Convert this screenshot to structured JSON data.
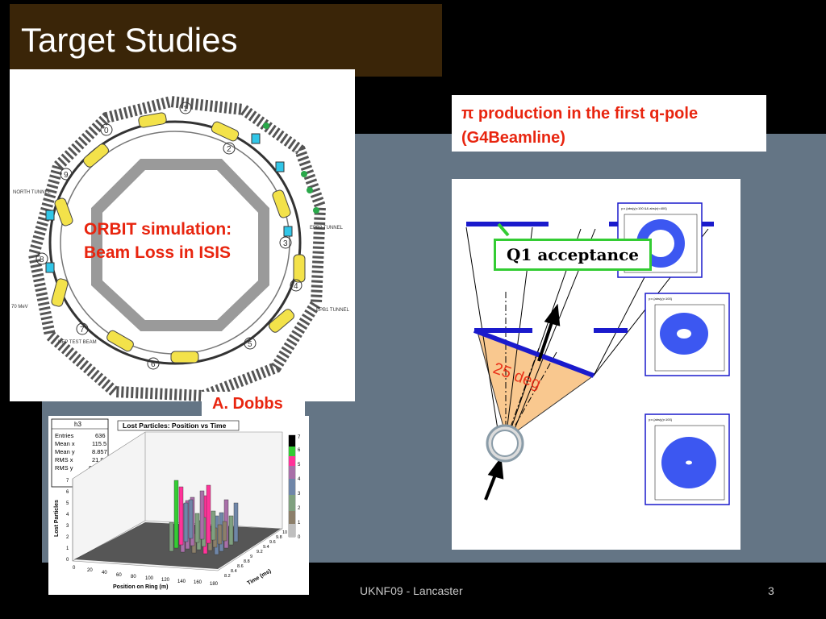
{
  "slide": {
    "title": "Target Studies",
    "footer_center": "UKNF09 - Lancaster",
    "page_number": "3"
  },
  "ring": {
    "label": "ORBIT simulation: Beam Loss in ISIS",
    "ring_numbers": [
      "1",
      "2",
      "3",
      "4",
      "5",
      "6",
      "7",
      "8",
      "9",
      "0"
    ],
    "side_labels": [
      "NORTH TUNNEL",
      "EPB2 TUNNEL",
      "EPB1 TUNNEL",
      "HEP TEST BEAM",
      "70 MeV"
    ]
  },
  "credit": "A. Dobbs",
  "histogram": {
    "title": "Lost Particles: Position vs Time",
    "stats": {
      "name": "h3",
      "rows": [
        {
          "k": "Entries",
          "v": "636"
        },
        {
          "k": "Mean x",
          "v": "115.5"
        },
        {
          "k": "Mean y",
          "v": "8.857"
        },
        {
          "k": "RMS x",
          "v": "21.92"
        },
        {
          "k": "RMS y",
          "v": "0.5634"
        }
      ]
    },
    "zlabel": "Lost Particles",
    "xlabel": "Position on Ring (m)",
    "ylabel": "Time (ms)",
    "x_ticks": [
      "0",
      "20",
      "40",
      "60",
      "80",
      "100",
      "120",
      "140",
      "160",
      "180"
    ],
    "y_ticks": [
      "8.2",
      "8.4",
      "8.6",
      "8.8",
      "9",
      "9.2",
      "9.4",
      "9.6",
      "9.8",
      "10"
    ],
    "z_ticks": [
      "0",
      "1",
      "2",
      "3",
      "4",
      "5",
      "6",
      "7"
    ],
    "palette_ticks": [
      "0",
      "1",
      "2",
      "3",
      "4",
      "5",
      "6",
      "7"
    ],
    "colors": {
      "palette": [
        "#ffffff",
        "#bfbfbf",
        "#8c7f6a",
        "#7fa07f",
        "#6f86a8",
        "#a86fa8",
        "#ff3399",
        "#33cc33"
      ]
    }
  },
  "pi_production": {
    "line1": "π production in the first q-pole",
    "line2": "(G4Beamline)"
  },
  "diagram": {
    "callout": "Q1 acceptance",
    "angle_label": "25 deg",
    "plot_headers": [
      "y:x {abs(y)<100 && abs(x)<400}",
      "y:x {abs(y)<100}",
      "y:x {abs(y)<100}"
    ],
    "colors": {
      "beam": "#1a1acc",
      "cone": "#f9c88f",
      "quad": "#1a1acc",
      "accent": "#e8250f"
    }
  }
}
